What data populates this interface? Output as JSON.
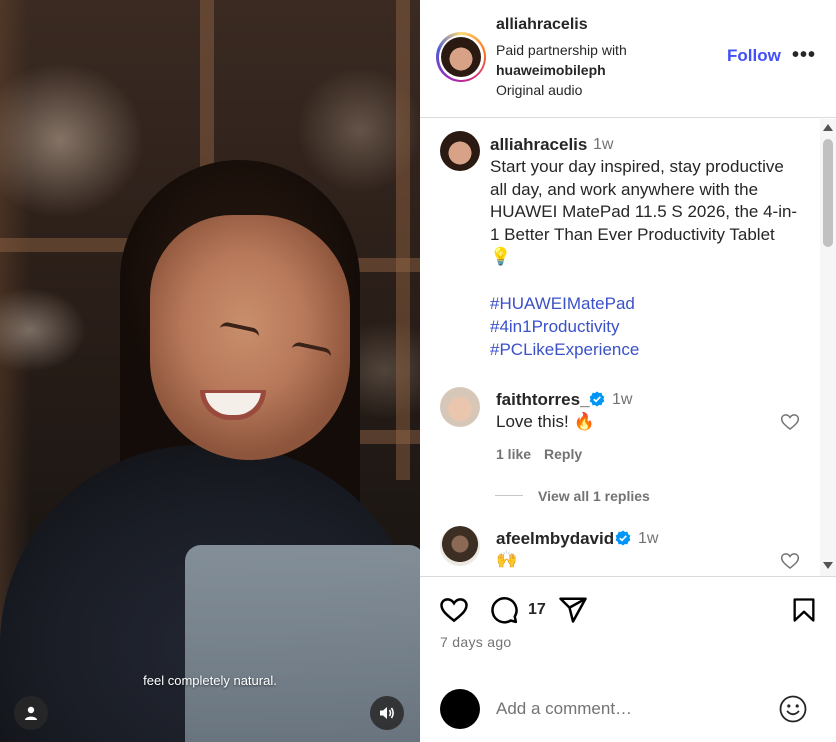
{
  "video": {
    "caption": "feel completely natural."
  },
  "header": {
    "username": "alliahracelis",
    "partnership_prefix": "Paid partnership with",
    "partner": "huaweimobileph",
    "audio": "Original audio",
    "follow_label": "Follow",
    "more_label": "•••"
  },
  "post": {
    "username": "alliahracelis",
    "time": "1w",
    "caption_lines": [
      "Start your day inspired, stay productive",
      "all day, and work anywhere with the",
      "HUAWEI MatePad 11.5 S 2026, the 4-in-",
      "1 Better Than Ever Productivity Tablet",
      "💡"
    ],
    "hashtags": [
      "#HUAWEIMatePad",
      "#4in1Productivity",
      "#PCLikeExperience"
    ]
  },
  "comments": [
    {
      "username": "faithtorres_",
      "time": "1w",
      "text": "Love this! 🔥",
      "likes": "1 like",
      "reply_label": "Reply",
      "view_replies": "View all 1 replies"
    },
    {
      "username": "afeelmbydavid",
      "time": "1w",
      "text": "🙌"
    }
  ],
  "actions": {
    "comment_count": "17",
    "date": "7 days ago"
  },
  "composer": {
    "placeholder": "Add a comment…"
  },
  "colors": {
    "link": "#3b51c8",
    "follow": "#4150f7",
    "verified": "#0095f6",
    "muted": "#737373"
  },
  "icons": [
    "user-icon",
    "volume-icon",
    "verified-icon",
    "heart-icon",
    "comment-icon",
    "share-icon",
    "bookmark-icon",
    "emoji-icon",
    "more-icon"
  ]
}
